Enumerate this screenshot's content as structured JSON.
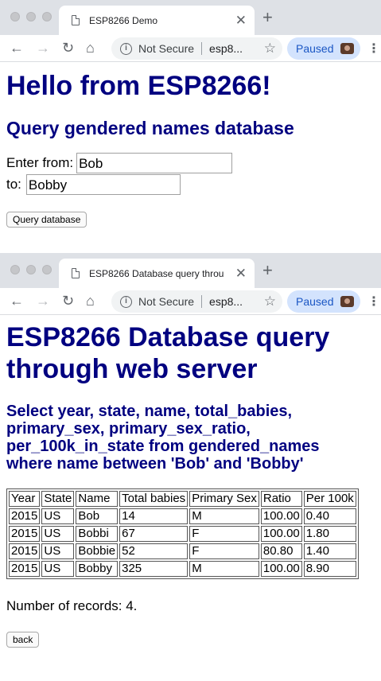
{
  "browser_top": {
    "tab_title": "ESP8266 Demo",
    "security_label": "Not Secure",
    "url": "esp8...",
    "paused_label": "Paused"
  },
  "page1": {
    "heading": "Hello from ESP8266!",
    "subheading": "Query gendered names database",
    "from_label": "Enter from:",
    "from_value": "Bob",
    "to_label": "to:",
    "to_value": "Bobby",
    "submit_label": "Query database"
  },
  "browser_bottom": {
    "tab_title": "ESP8266 Database query throu",
    "security_label": "Not Secure",
    "url": "esp8...",
    "paused_label": "Paused"
  },
  "page2": {
    "heading_line1": "ESP8266 Database query",
    "heading_line2": "through web server",
    "query_line1": "Select year, state, name, total_babies,",
    "query_line2": "primary_sex, primary_sex_ratio,",
    "query_line3": "per_100k_in_state from gendered_names",
    "query_line4": "where name between 'Bob' and 'Bobby'",
    "columns": [
      "Year",
      "State",
      "Name",
      "Total babies",
      "Primary Sex",
      "Ratio",
      "Per 100k"
    ],
    "rows": [
      [
        "2015",
        "US",
        "Bob",
        "14",
        "M",
        "100.00",
        "0.40"
      ],
      [
        "2015",
        "US",
        "Bobbi",
        "67",
        "F",
        "100.00",
        "1.80"
      ],
      [
        "2015",
        "US",
        "Bobbie",
        "52",
        "F",
        "80.80",
        "1.40"
      ],
      [
        "2015",
        "US",
        "Bobby",
        "325",
        "M",
        "100.00",
        "8.90"
      ]
    ],
    "records_text": "Number of records: 4.",
    "back_label": "back"
  }
}
